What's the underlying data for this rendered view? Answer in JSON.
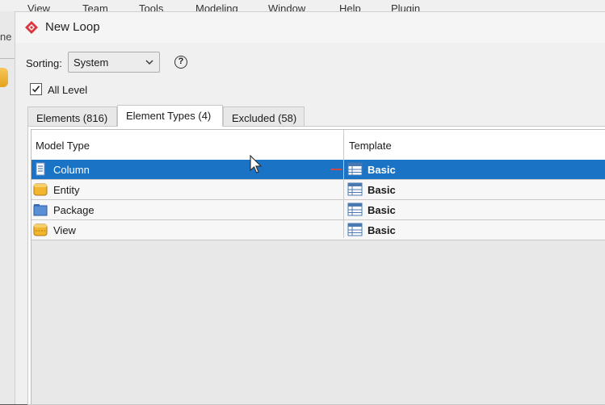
{
  "background": {
    "menu": [
      "View",
      "Team",
      "Tools",
      "Modeling",
      "Window",
      "Help",
      "Plugin"
    ],
    "left_fragment": "ne"
  },
  "dialog": {
    "title": "New Loop",
    "sorting_label": "Sorting:",
    "sorting_value": "System",
    "help_symbol": "?",
    "all_level_label": "All Level",
    "all_level_checked": true,
    "tabs": [
      {
        "label": "Elements (816)",
        "active": false
      },
      {
        "label": "Element Types (4)",
        "active": true
      },
      {
        "label": "Excluded (58)",
        "active": false
      }
    ],
    "table": {
      "columns": [
        "Model Type",
        "Template"
      ],
      "rows": [
        {
          "type": "Column",
          "icon": "column-icon",
          "template": "Basic",
          "selected": true
        },
        {
          "type": "Entity",
          "icon": "entity-icon",
          "template": "Basic",
          "selected": false
        },
        {
          "type": "Package",
          "icon": "package-icon",
          "template": "Basic",
          "selected": false
        },
        {
          "type": "View",
          "icon": "view-icon",
          "template": "Basic",
          "selected": false
        }
      ]
    }
  },
  "colors": {
    "selection": "#1a73c4",
    "brand_red": "#d9363e"
  }
}
